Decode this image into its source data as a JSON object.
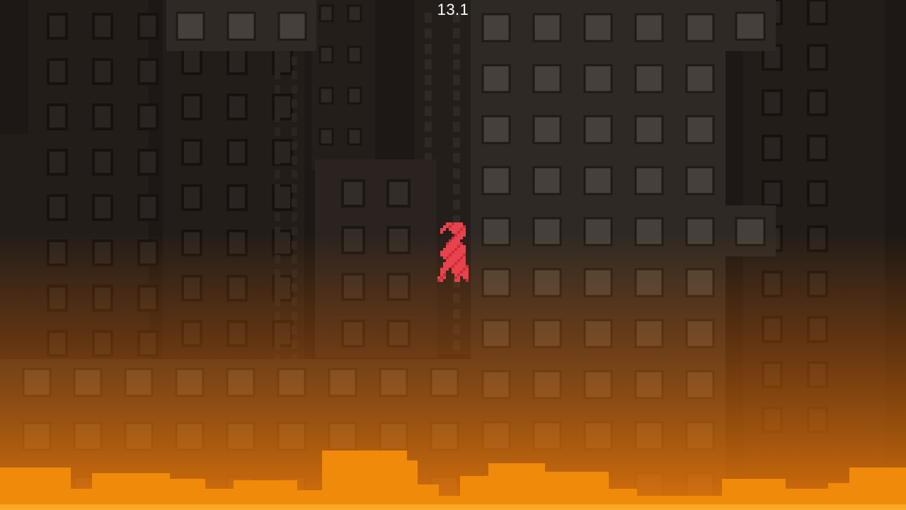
{
  "hud": {
    "timer": "13.1"
  },
  "player": {
    "icon": "red-pixel-creature-icon",
    "color": "#e8434c"
  },
  "palette": {
    "sky_top": "#1d1815",
    "lava_glow": "#c25a06",
    "lava": "#f08a0a",
    "window": "#45403b",
    "building_front": "#2f2925",
    "building_back": "#231d1a"
  }
}
